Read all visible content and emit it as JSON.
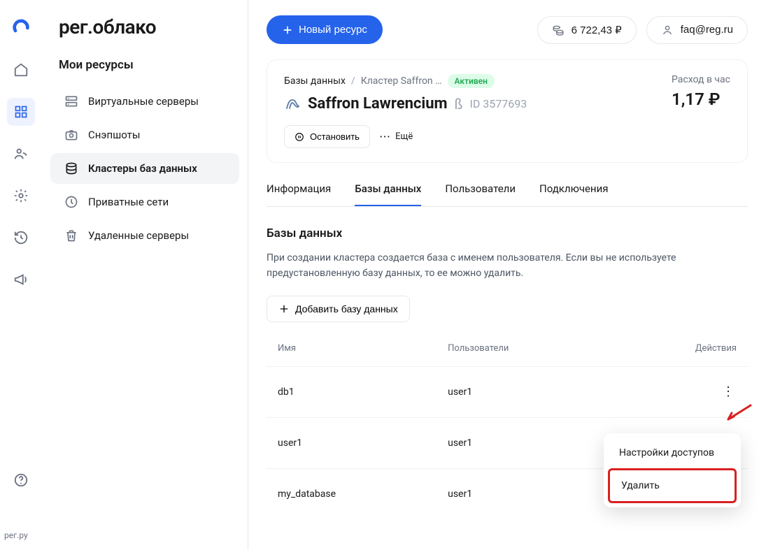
{
  "brand": "рег.облако",
  "rail_footer": "рег.ру",
  "sidebar": {
    "heading": "Мои ресурсы",
    "items": [
      {
        "label": "Виртуальные серверы"
      },
      {
        "label": "Снэпшоты"
      },
      {
        "label": "Кластеры баз данных"
      },
      {
        "label": "Приватные сети"
      },
      {
        "label": "Удаленные серверы"
      }
    ]
  },
  "topbar": {
    "new_resource": "Новый ресурс",
    "balance": "6 722,43 ₽",
    "account": "faq@reg.ru"
  },
  "cluster": {
    "crumb_root": "Базы данных",
    "crumb_sep": "/",
    "crumb_current": "Кластер Saffron …",
    "status": "Активен",
    "name": "Saffron Lawrencium",
    "beta": "ß",
    "id_label": "ID 3577693",
    "cost_label": "Расход в час",
    "cost_value": "1,17 ₽",
    "stop_label": "Остановить",
    "more_label": "Ещё"
  },
  "tabs": {
    "info": "Информация",
    "databases": "Базы данных",
    "users": "Пользователи",
    "connections": "Подключения"
  },
  "db_section": {
    "title": "Базы данных",
    "description": "При создании кластера создается база с именем пользователя. Если вы не используете предустановленную базу данных, то ее можно удалить.",
    "add_button": "Добавить базу данных",
    "col_name": "Имя",
    "col_users": "Пользователи",
    "col_actions": "Действия",
    "rows": [
      {
        "name": "db1",
        "user": "user1"
      },
      {
        "name": "user1",
        "user": "user1"
      },
      {
        "name": "my_database",
        "user": "user1"
      }
    ]
  },
  "popover": {
    "settings": "Настройки доступов",
    "delete": "Удалить"
  }
}
